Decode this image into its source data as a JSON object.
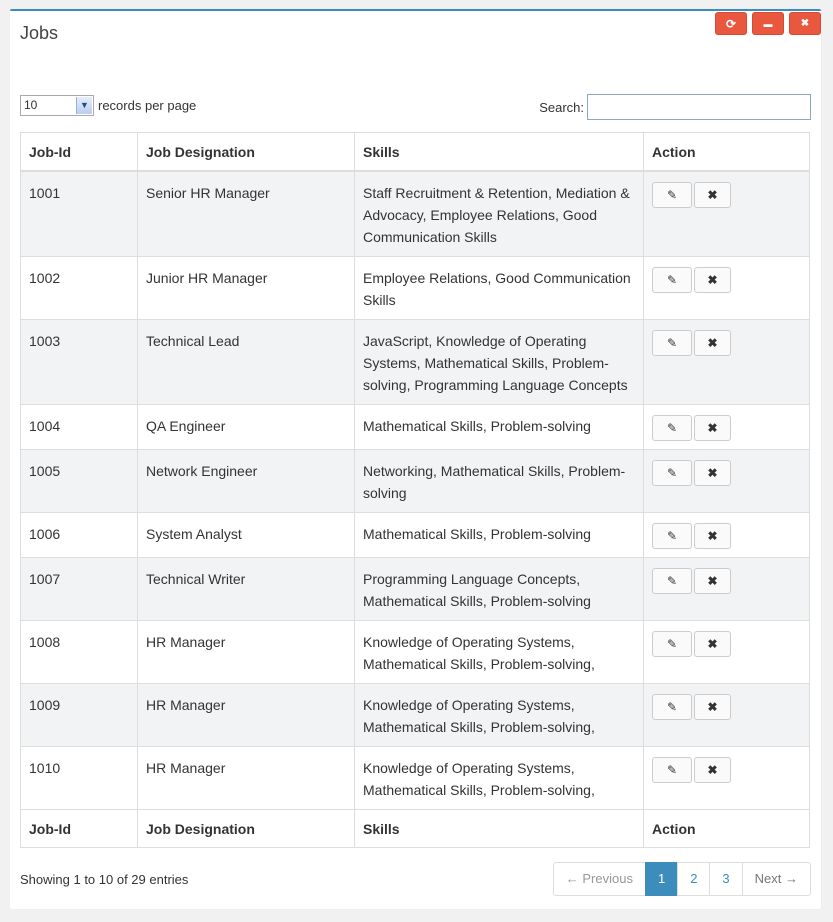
{
  "panel": {
    "title": "Jobs",
    "buttons": [
      {
        "name": "refresh-icon",
        "glyph": "⟳"
      },
      {
        "name": "minimize-icon",
        "glyph": "▬"
      },
      {
        "name": "close-icon",
        "glyph": "✖"
      }
    ]
  },
  "length": {
    "value": "10",
    "label": "records per page"
  },
  "search": {
    "label": "Search:",
    "value": "",
    "placeholder": ""
  },
  "table": {
    "headers": [
      "Job-Id",
      "Job Designation",
      "Skills",
      "Action"
    ],
    "rows": [
      {
        "id": "1001",
        "designation": "Senior HR Manager",
        "skills": "Staff Recruitment & Retention, Mediation & Advocacy, Employee Relations, Good Communication Skills"
      },
      {
        "id": "1002",
        "designation": "Junior HR Manager",
        "skills": "Employee Relations, Good Communication Skills"
      },
      {
        "id": "1003",
        "designation": "Technical Lead",
        "skills": "JavaScript, Knowledge of Operating Systems, Mathematical Skills, Problem-solving, Programming Language Concepts"
      },
      {
        "id": "1004",
        "designation": "QA Engineer",
        "skills": "Mathematical Skills, Problem-solving"
      },
      {
        "id": "1005",
        "designation": "Network Engineer",
        "skills": "Networking, Mathematical Skills, Problem-solving"
      },
      {
        "id": "1006",
        "designation": "System Analyst",
        "skills": "Mathematical Skills, Problem-solving"
      },
      {
        "id": "1007",
        "designation": "Technical Writer",
        "skills": "Programming Language Concepts, Mathematical Skills, Problem-solving"
      },
      {
        "id": "1008",
        "designation": "HR Manager",
        "skills": "Knowledge of Operating Systems, Mathematical Skills, Problem-solving,"
      },
      {
        "id": "1009",
        "designation": "HR Manager",
        "skills": "Knowledge of Operating Systems, Mathematical Skills, Problem-solving,"
      },
      {
        "id": "1010",
        "designation": "HR Manager",
        "skills": "Knowledge of Operating Systems, Mathematical Skills, Problem-solving,"
      }
    ],
    "edit_icon": "✎",
    "delete_icon": "✖"
  },
  "info": "Showing 1 to 10 of 29 entries",
  "pagination": {
    "previous": "← Previous",
    "pages": [
      "1",
      "2",
      "3"
    ],
    "active_page": "1",
    "next": "Next →"
  }
}
